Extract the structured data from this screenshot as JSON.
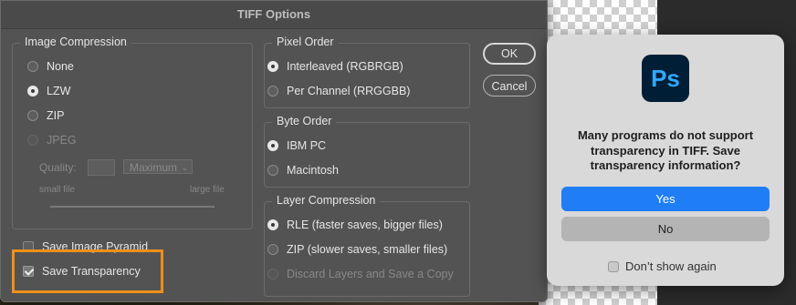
{
  "dialog": {
    "title": "TIFF Options",
    "ok_label": "OK",
    "cancel_label": "Cancel"
  },
  "image_compression": {
    "title": "Image Compression",
    "options": [
      "None",
      "LZW",
      "ZIP",
      "JPEG"
    ],
    "selected": "LZW",
    "quality_label": "Quality:",
    "quality_value": "",
    "quality_preset": "Maximum",
    "small_file_label": "small file",
    "large_file_label": "large file"
  },
  "pixel_order": {
    "title": "Pixel Order",
    "options": [
      "Interleaved (RGBRGB)",
      "Per Channel (RRGGBB)"
    ],
    "selected": "Interleaved (RGBRGB)"
  },
  "byte_order": {
    "title": "Byte Order",
    "options": [
      "IBM PC",
      "Macintosh"
    ],
    "selected": "IBM PC"
  },
  "layer_compression": {
    "title": "Layer Compression",
    "options": [
      "RLE (faster saves, bigger files)",
      "ZIP (slower saves, smaller files)",
      "Discard Layers and Save a Copy"
    ],
    "selected": "RLE (faster saves, bigger files)"
  },
  "save_image_pyramid": {
    "label": "Save Image Pyramid",
    "checked": false
  },
  "save_transparency": {
    "label": "Save Transparency",
    "checked": true
  },
  "alert": {
    "app_icon_text": "Ps",
    "message": "Many programs do not support transparency in TIFF.  Save transparency information?",
    "yes_label": "Yes",
    "no_label": "No",
    "dont_show_label": "Don’t show again"
  },
  "colors": {
    "highlight": "#ef8f1a",
    "primary_button": "#1f7df5",
    "ps_icon_bg": "#001e36",
    "ps_icon_fg": "#31a8ff"
  }
}
